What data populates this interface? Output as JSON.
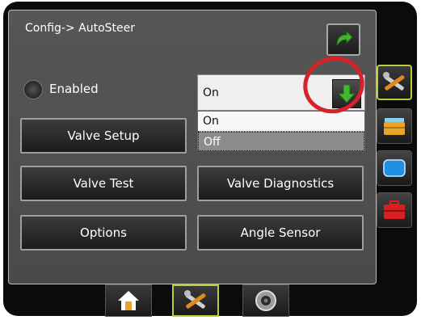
{
  "header": {
    "title": "Config-> AutoSteer"
  },
  "autosteer": {
    "enabled_label": "Enabled"
  },
  "dropdown": {
    "value": "On",
    "options": [
      "On",
      "Off"
    ],
    "highlighted": "Off"
  },
  "buttons": {
    "valve_setup": "Valve Setup",
    "valve_test": "Valve Test",
    "valve_diagnostics": "Valve Diagnostics",
    "options": "Options",
    "angle_sensor": "Angle Sensor"
  },
  "icons": {
    "back": "green-u-turn-arrow-icon",
    "dropdown": "green-down-arrow-icon",
    "status": "steering-wheel-icon",
    "side_tabs": [
      "tools-icon",
      "toolbox-icon",
      "screen-icon",
      "red-toolbox-icon"
    ],
    "bottom_tabs": [
      "home-icon",
      "tools-icon",
      "camera-icon"
    ]
  },
  "colors": {
    "accent_green": "#3fae2a",
    "active_tab_border": "#b6cf3a",
    "annotation_red": "#d5232a"
  }
}
